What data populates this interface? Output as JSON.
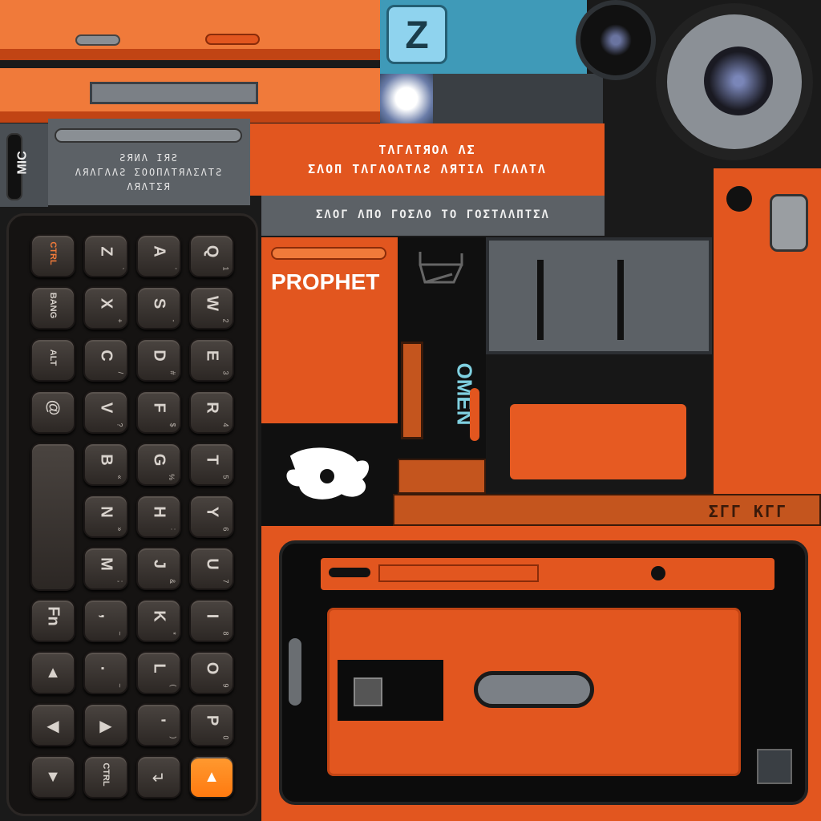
{
  "labels": {
    "mic": "MIC",
    "brand": "PROPHET",
    "omen": "OMEN",
    "alien_line_1": "ƧЯИΛ ΙЯƧ",
    "alien_line_2": "ΛЯΛΓΛΛƧ ΣΟΟΠΛΤЯΛΣΛΤƧ",
    "alien_line_3": "ΛЯΛΤΣЯ",
    "alien_banner_1": "ΤΛΓΛΤЯΟΛ ΛΣ",
    "alien_banner_2": "ΣΛΟΠ ΤΛΓΛΟΛΤΛƧ ΛЯΤΙΛ ΓΛΛΛΤΛ",
    "alien_banner_3": "ΣΛΟΓ ΛΠΟ ΓΟΣΛΟ ΤΟ ΓΟΣΤΛΛΠΤΣΛ",
    "bottom_scratch": "ΣΓΓ ΚΓΓ"
  },
  "app_icon": "Z",
  "keyboard": {
    "rows": [
      [
        {
          "main": "CTRL",
          "small": true,
          "accent": true
        },
        {
          "main": "Z",
          "sub": "`"
        },
        {
          "main": "A",
          "sub": "'"
        },
        {
          "main": "Q",
          "sub": "1"
        }
      ],
      [
        {
          "main": "BANG",
          "small": true
        },
        {
          "main": "X",
          "sub": "+"
        },
        {
          "main": "S",
          "sub": "-"
        },
        {
          "main": "W",
          "sub": "2"
        }
      ],
      [
        {
          "main": "ALT",
          "small": true
        },
        {
          "main": "C",
          "sub": "/"
        },
        {
          "main": "D",
          "sub": "#"
        },
        {
          "main": "E",
          "sub": "3"
        }
      ],
      [
        {
          "main": "@"
        },
        {
          "main": "V",
          "sub": "?"
        },
        {
          "main": "F",
          "sub": "$"
        },
        {
          "main": "R",
          "sub": "4"
        }
      ],
      [
        {
          "main": "",
          "spacer": true
        },
        {
          "main": "B",
          "sub": "«"
        },
        {
          "main": "G",
          "sub": "%"
        },
        {
          "main": "T",
          "sub": "5"
        }
      ],
      [
        {
          "main": "",
          "spacer": true
        },
        {
          "main": "N",
          "sub": "»"
        },
        {
          "main": "H",
          "sub": ":"
        },
        {
          "main": "Y",
          "sub": "6"
        }
      ],
      [
        {
          "main": "",
          "spacer": true
        },
        {
          "main": "M",
          "sub": ";"
        },
        {
          "main": "J",
          "sub": "&"
        },
        {
          "main": "U",
          "sub": "7"
        }
      ],
      [
        {
          "main": "Fn"
        },
        {
          "main": ",",
          "sub": "~"
        },
        {
          "main": "K",
          "sub": "*"
        },
        {
          "main": "I",
          "sub": "8"
        }
      ],
      [
        {
          "main": "▲",
          "arrow": true
        },
        {
          "main": ".",
          "sub": "~"
        },
        {
          "main": "L",
          "sub": "("
        },
        {
          "main": "O",
          "sub": "9"
        }
      ],
      [
        {
          "main": "◀",
          "arrow": true
        },
        {
          "main": "▶",
          "arrow": true
        },
        {
          "main": "'",
          "sub": ")"
        },
        {
          "main": "P",
          "sub": "0"
        }
      ],
      [
        {
          "main": "▼",
          "arrow": true
        },
        {
          "main": "CTRL",
          "small": true
        },
        {
          "main": "↵",
          "arrow": true
        },
        {
          "main": "▲",
          "arrow": true,
          "highlight": true
        }
      ]
    ]
  },
  "colors": {
    "orange": "#e2561f",
    "orange_light": "#f07a3a",
    "gray": "#5c6166",
    "dark": "#101010",
    "omen_blue": "#7fd0e0",
    "highlight": "#ff7a10"
  }
}
